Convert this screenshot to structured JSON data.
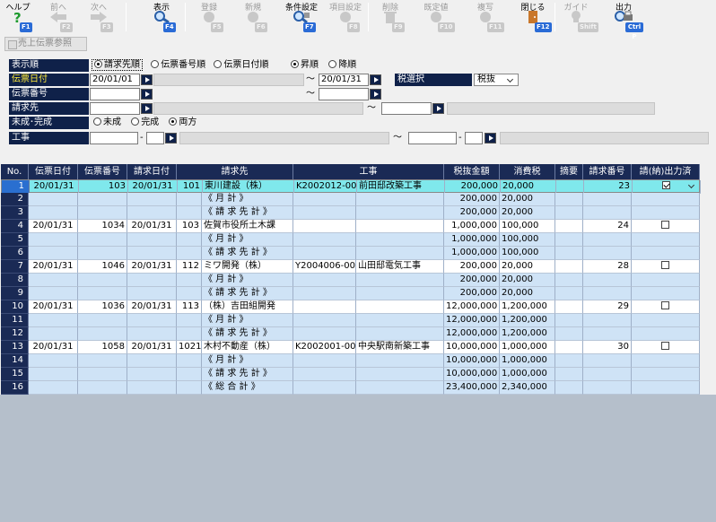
{
  "toolbar": {
    "buttons": [
      {
        "label": "ヘルプ",
        "key": "F1",
        "icon": "help-icon",
        "enabled": true
      },
      {
        "label": "前へ",
        "key": "F2",
        "icon": "arrow-left-icon",
        "enabled": false
      },
      {
        "label": "次へ",
        "key": "F3",
        "icon": "arrow-right-icon",
        "enabled": false
      },
      {
        "label": "表示",
        "key": "F4",
        "icon": "magnifier-icon",
        "enabled": true
      },
      {
        "label": "登録",
        "key": "F5",
        "icon": "register-icon",
        "enabled": false
      },
      {
        "label": "新規",
        "key": "F6",
        "icon": "new-icon",
        "enabled": false
      },
      {
        "label": "条件設定",
        "key": "F7",
        "icon": "condition-icon",
        "enabled": true
      },
      {
        "label": "項目設定",
        "key": "F8",
        "icon": "item-settings-icon",
        "enabled": false
      },
      {
        "label": "削除",
        "key": "F9",
        "icon": "trash-icon",
        "enabled": false
      },
      {
        "label": "既定値",
        "key": "F10",
        "icon": "default-icon",
        "enabled": false
      },
      {
        "label": "複写",
        "key": "F11",
        "icon": "copy-icon",
        "enabled": false
      },
      {
        "label": "閉じる",
        "key": "F12",
        "icon": "close-door-icon",
        "enabled": true
      },
      {
        "label": "ガイド",
        "key": "Shift",
        "icon": "bulb-icon",
        "enabled": false
      },
      {
        "label": "出力",
        "key": "Ctrl P",
        "icon": "print-icon",
        "enabled": true
      }
    ]
  },
  "ref_button": "売上伝票参照",
  "filters": {
    "sort_label": "表示順",
    "sort_options": [
      "請求先順",
      "伝票番号順",
      "伝票日付順"
    ],
    "sort_selected": "請求先順",
    "order_options": [
      "昇順",
      "降順"
    ],
    "order_selected": "昇順",
    "date_label": "伝票日付",
    "date_from": "20/01/01",
    "date_to": "20/01/31",
    "tilde": "～",
    "tax_label": "税選択",
    "tax_value": "税抜",
    "voucher_label": "伝票番号",
    "voucher_from": "",
    "voucher_to": "",
    "billing_label": "請求先",
    "billing_from": "",
    "billing_to": "",
    "status_label": "未成･完成",
    "status_options": [
      "未成",
      "完成",
      "両方"
    ],
    "status_selected": "両方",
    "work_label": "工事",
    "dash": "-"
  },
  "grid": {
    "headers": [
      "No.",
      "伝票日付",
      "伝票番号",
      "請求日付",
      "請求先",
      "工事",
      "税抜金額",
      "消費税",
      "摘要",
      "請求番号",
      "請(納)出力済"
    ],
    "rows": [
      {
        "no": "1",
        "date": "20/01/31",
        "voucher": "103",
        "bill_date": "20/01/31",
        "code": "101",
        "name": "東川建設（株）",
        "work_code": "K2002012-00",
        "work_name": "前田邸改築工事",
        "amount": "200,000",
        "tax": "20,000",
        "note": "",
        "bill_no": "23",
        "check": "on",
        "style": "sel"
      },
      {
        "no": "2",
        "date": "",
        "voucher": "",
        "bill_date": "",
        "code": "",
        "name": "《 月 計 》",
        "work_code": "",
        "work_name": "",
        "amount": "200,000",
        "tax": "20,000",
        "note": "",
        "bill_no": "",
        "check": "",
        "style": "blue"
      },
      {
        "no": "3",
        "date": "",
        "voucher": "",
        "bill_date": "",
        "code": "",
        "name": "《 請 求 先 計 》",
        "work_code": "",
        "work_name": "",
        "amount": "200,000",
        "tax": "20,000",
        "note": "",
        "bill_no": "",
        "check": "",
        "style": "blue"
      },
      {
        "no": "4",
        "date": "20/01/31",
        "voucher": "1034",
        "bill_date": "20/01/31",
        "code": "103",
        "name": "佐賀市役所土木課",
        "work_code": "",
        "work_name": "",
        "amount": "1,000,000",
        "tax": "100,000",
        "note": "",
        "bill_no": "24",
        "check": "off",
        "style": "white"
      },
      {
        "no": "5",
        "date": "",
        "voucher": "",
        "bill_date": "",
        "code": "",
        "name": "《 月 計 》",
        "work_code": "",
        "work_name": "",
        "amount": "1,000,000",
        "tax": "100,000",
        "note": "",
        "bill_no": "",
        "check": "",
        "style": "blue"
      },
      {
        "no": "6",
        "date": "",
        "voucher": "",
        "bill_date": "",
        "code": "",
        "name": "《 請 求 先 計 》",
        "work_code": "",
        "work_name": "",
        "amount": "1,000,000",
        "tax": "100,000",
        "note": "",
        "bill_no": "",
        "check": "",
        "style": "blue"
      },
      {
        "no": "7",
        "date": "20/01/31",
        "voucher": "1046",
        "bill_date": "20/01/31",
        "code": "112",
        "name": "ミワ開発（株）",
        "work_code": "Y2004006-00",
        "work_name": "山田邸電気工事",
        "amount": "200,000",
        "tax": "20,000",
        "note": "",
        "bill_no": "28",
        "check": "off",
        "style": "white"
      },
      {
        "no": "8",
        "date": "",
        "voucher": "",
        "bill_date": "",
        "code": "",
        "name": "《 月 計 》",
        "work_code": "",
        "work_name": "",
        "amount": "200,000",
        "tax": "20,000",
        "note": "",
        "bill_no": "",
        "check": "",
        "style": "blue"
      },
      {
        "no": "9",
        "date": "",
        "voucher": "",
        "bill_date": "",
        "code": "",
        "name": "《 請 求 先 計 》",
        "work_code": "",
        "work_name": "",
        "amount": "200,000",
        "tax": "20,000",
        "note": "",
        "bill_no": "",
        "check": "",
        "style": "blue"
      },
      {
        "no": "10",
        "date": "20/01/31",
        "voucher": "1036",
        "bill_date": "20/01/31",
        "code": "113",
        "name": "（株）吉田組開発",
        "work_code": "",
        "work_name": "",
        "amount": "12,000,000",
        "tax": "1,200,000",
        "note": "",
        "bill_no": "29",
        "check": "off",
        "style": "white"
      },
      {
        "no": "11",
        "date": "",
        "voucher": "",
        "bill_date": "",
        "code": "",
        "name": "《 月 計 》",
        "work_code": "",
        "work_name": "",
        "amount": "12,000,000",
        "tax": "1,200,000",
        "note": "",
        "bill_no": "",
        "check": "",
        "style": "blue"
      },
      {
        "no": "12",
        "date": "",
        "voucher": "",
        "bill_date": "",
        "code": "",
        "name": "《 請 求 先 計 》",
        "work_code": "",
        "work_name": "",
        "amount": "12,000,000",
        "tax": "1,200,000",
        "note": "",
        "bill_no": "",
        "check": "",
        "style": "blue"
      },
      {
        "no": "13",
        "date": "20/01/31",
        "voucher": "1058",
        "bill_date": "20/01/31",
        "code": "1021",
        "name": "木村不動産（株）",
        "work_code": "K2002001-00",
        "work_name": "中央駅南新築工事",
        "amount": "10,000,000",
        "tax": "1,000,000",
        "note": "",
        "bill_no": "30",
        "check": "off",
        "style": "white"
      },
      {
        "no": "14",
        "date": "",
        "voucher": "",
        "bill_date": "",
        "code": "",
        "name": "《 月 計 》",
        "work_code": "",
        "work_name": "",
        "amount": "10,000,000",
        "tax": "1,000,000",
        "note": "",
        "bill_no": "",
        "check": "",
        "style": "blue"
      },
      {
        "no": "15",
        "date": "",
        "voucher": "",
        "bill_date": "",
        "code": "",
        "name": "《 請 求 先 計 》",
        "work_code": "",
        "work_name": "",
        "amount": "10,000,000",
        "tax": "1,000,000",
        "note": "",
        "bill_no": "",
        "check": "",
        "style": "blue"
      },
      {
        "no": "16",
        "date": "",
        "voucher": "",
        "bill_date": "",
        "code": "",
        "name": "《 総 合 計 》",
        "work_code": "",
        "work_name": "",
        "amount": "23,400,000",
        "tax": "2,340,000",
        "note": "",
        "bill_no": "",
        "check": "",
        "style": "blue"
      }
    ]
  },
  "colors": {
    "header_bg": "#1a2a55",
    "selected_row": "#7fe8ec",
    "row_blue": "#cfe3f6",
    "key_badge": "#2a6bd6"
  }
}
